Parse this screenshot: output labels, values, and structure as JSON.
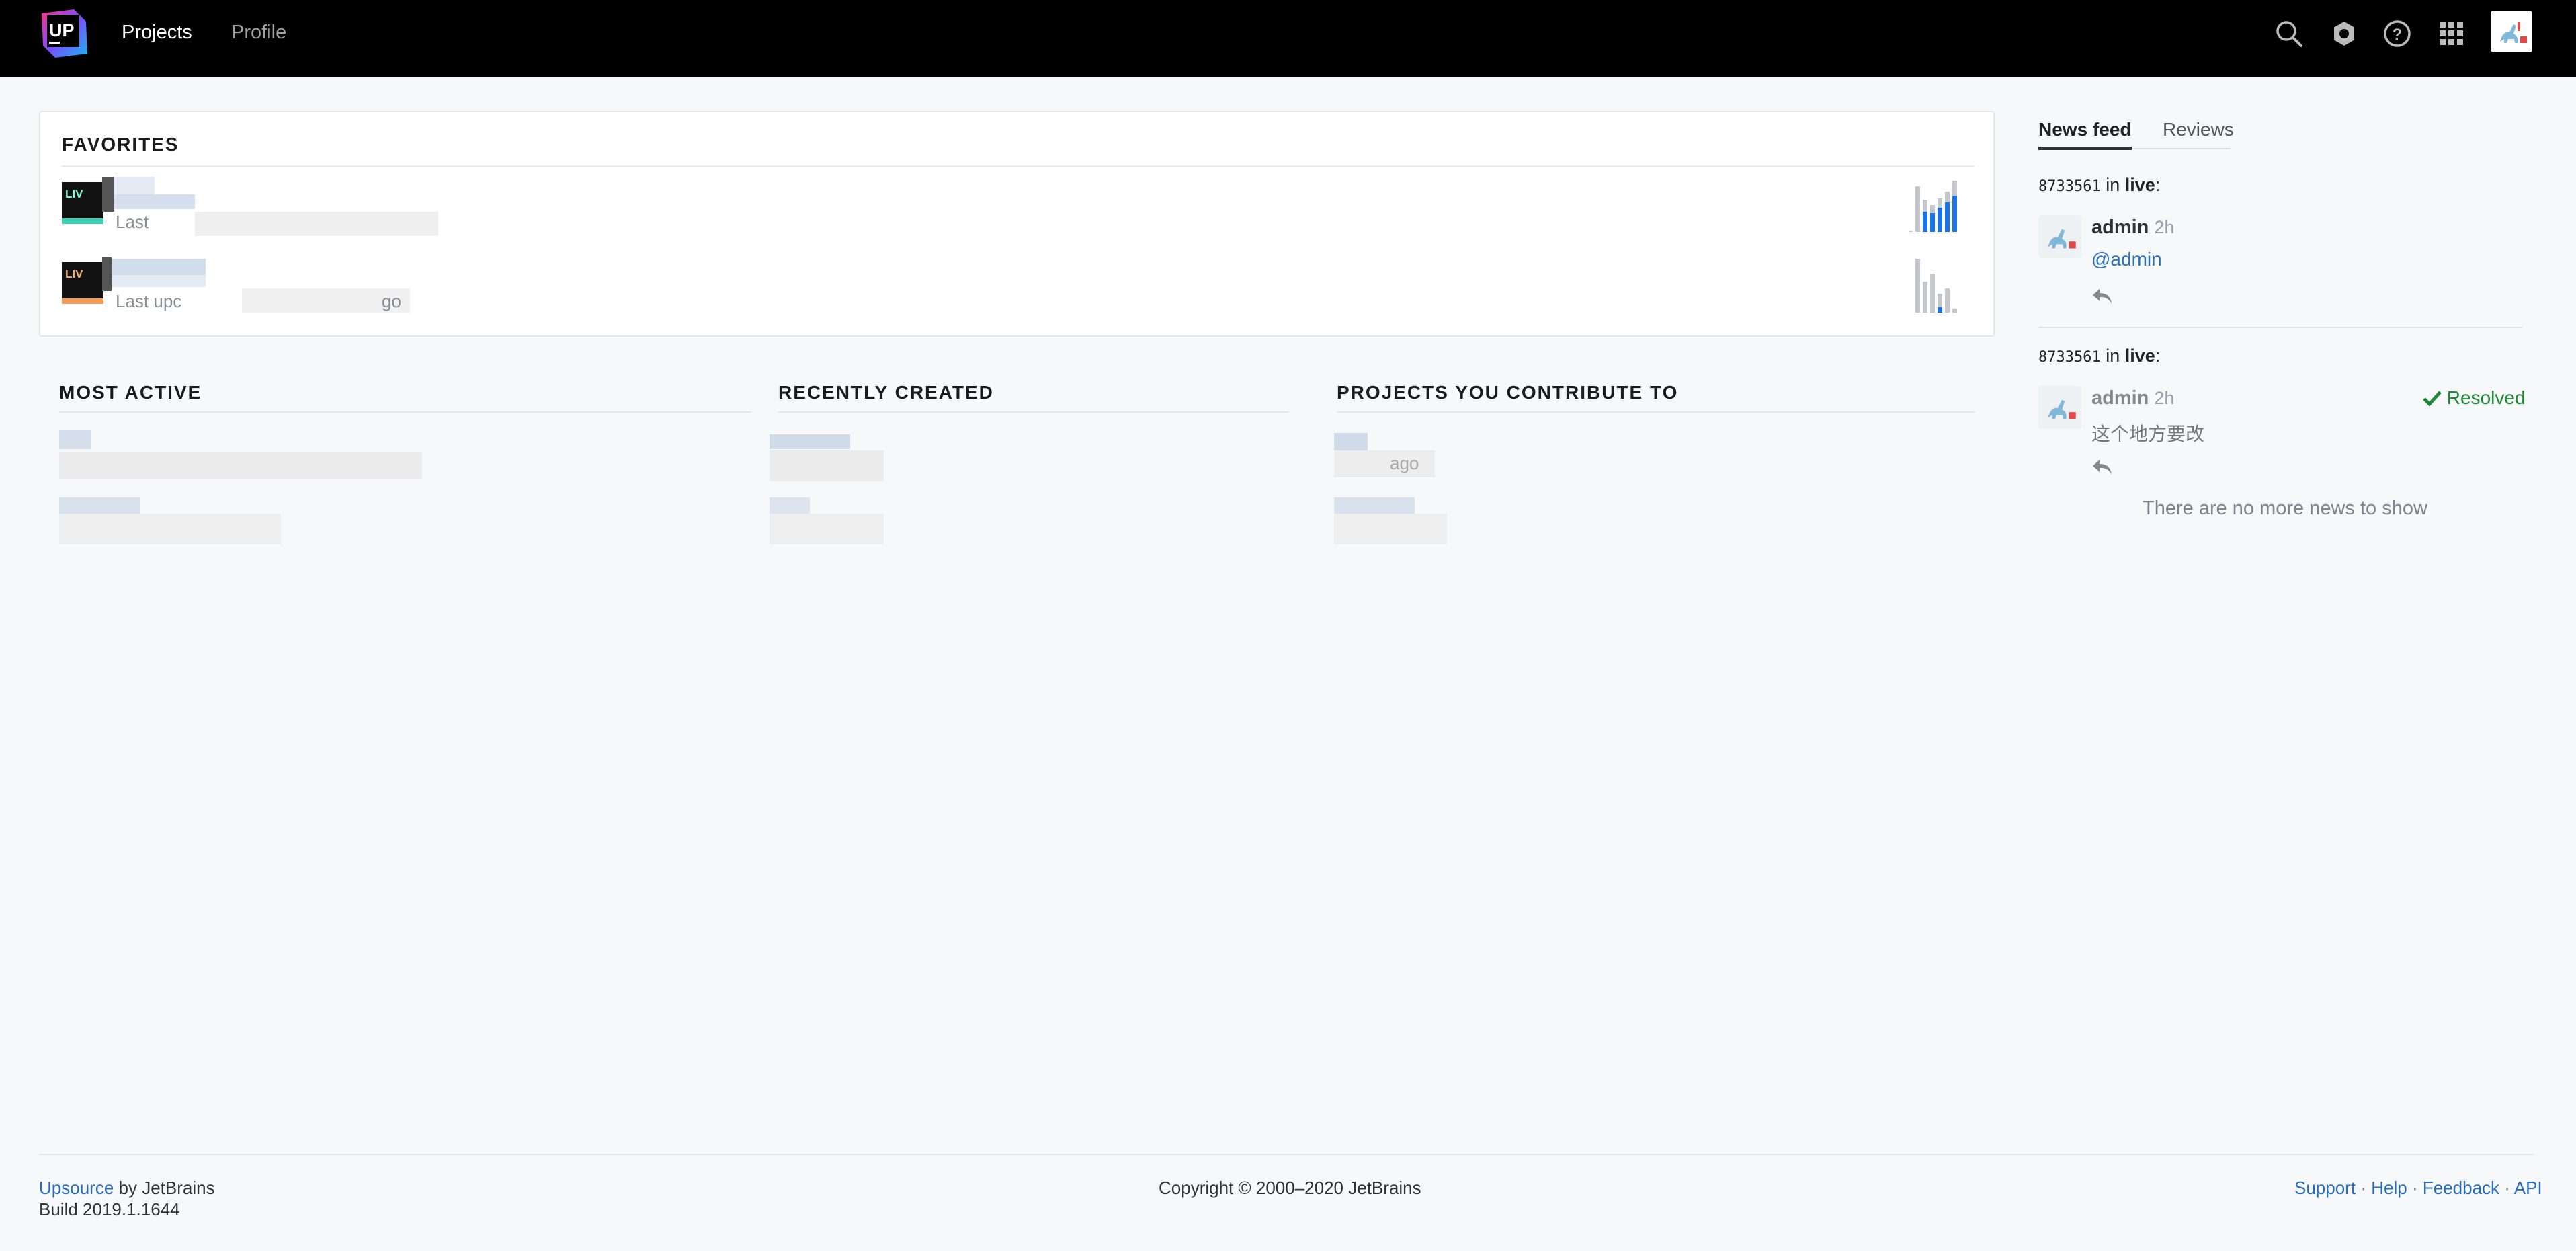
{
  "header": {
    "logo_text": "UP",
    "nav": [
      {
        "label": "Projects",
        "active": true
      },
      {
        "label": "Profile",
        "active": false
      }
    ],
    "icons": [
      "search-icon",
      "settings-icon",
      "help-icon",
      "apps-grid-icon"
    ]
  },
  "favorites": {
    "title": "FAVORITES",
    "items": [
      {
        "icon_label": "LIV",
        "subtitle": "Last"
      },
      {
        "icon_label": "LIV",
        "subtitle": "Last upc",
        "subtitle_tail": "go"
      }
    ]
  },
  "columns": {
    "most_active": {
      "title": "MOST ACTIVE"
    },
    "recently_created": {
      "title": "RECENTLY CREATED"
    },
    "contribute": {
      "title": "PROJECTS YOU CONTRIBUTE TO",
      "fragment": "ago"
    }
  },
  "news": {
    "tabs": [
      {
        "label": "News feed",
        "active": true
      },
      {
        "label": "Reviews",
        "active": false
      }
    ],
    "items": [
      {
        "revision": "8733561",
        "in_text": "in",
        "project": "live",
        "author": "admin",
        "time": "2h",
        "body": "@admin"
      },
      {
        "revision": "8733561",
        "in_text": "in",
        "project": "live",
        "author": "admin",
        "time": "2h",
        "body": "这个地方要改",
        "status": "Resolved"
      }
    ],
    "empty_message": "There are no more news to show"
  },
  "footer": {
    "product": "Upsource",
    "by": "by JetBrains",
    "build": "Build 2019.1.1644",
    "copyright": "Copyright © 2000–2020 JetBrains",
    "links": [
      "Support",
      "Help",
      "Feedback",
      "API"
    ],
    "separator": "·"
  },
  "colors": {
    "topbar": "#000000",
    "link": "#2a6ebb",
    "resolved": "#1f8a36",
    "spark_active": "#1a73e8",
    "spark_idle": "#c4c7cb"
  }
}
